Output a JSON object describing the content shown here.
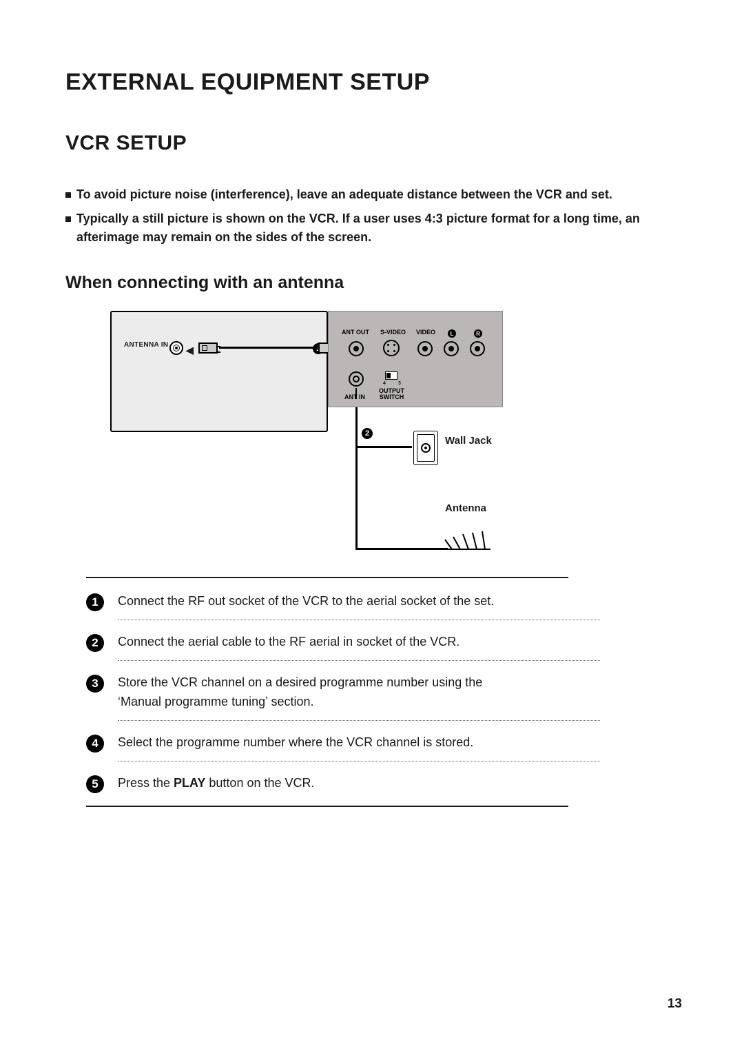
{
  "headings": {
    "h1": "EXTERNAL EQUIPMENT SETUP",
    "h2": "VCR SETUP",
    "h3": "When connecting with an antenna"
  },
  "bullets": [
    "To avoid picture noise (interference), leave an adequate distance between the VCR and set.",
    "Typically a still picture is shown on the VCR. If a user uses 4:3 picture format for a long time, an afterimage may remain on the sides of the screen."
  ],
  "diagram": {
    "tv_antenna_in": "ANTENNA IN",
    "vcr_labels": {
      "ant_out": "ANT OUT",
      "s_video": "S-VIDEO",
      "video": "VIDEO",
      "l": "L",
      "r": "R",
      "ant_in": "ANT IN",
      "output_switch_top": "OUTPUT",
      "output_switch_bottom": "SWITCH",
      "sw4": "4",
      "sw3": "3"
    },
    "wall_jack": "Wall Jack",
    "antenna": "Antenna",
    "badge1": "1",
    "badge2": "2"
  },
  "steps": [
    {
      "n": "1",
      "text": "Connect the RF out socket of the VCR to the aerial socket of the set."
    },
    {
      "n": "2",
      "text": "Connect the aerial cable to the RF aerial in socket of the VCR."
    },
    {
      "n": "3",
      "text": "Store the VCR channel on a desired programme number using the ‘Manual programme tuning’ section."
    },
    {
      "n": "4",
      "text": "Select the programme number where the VCR channel is stored."
    },
    {
      "n": "5",
      "text_pre": "Press the ",
      "text_bold": "PLAY",
      "text_post": " button on the VCR."
    }
  ],
  "page_number": "13"
}
